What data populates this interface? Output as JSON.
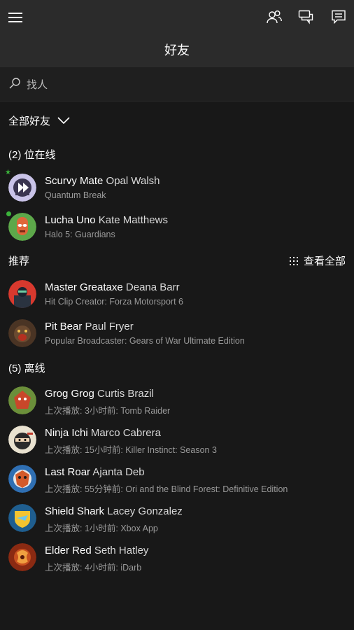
{
  "header": {
    "title": "好友"
  },
  "search": {
    "placeholder": "找人"
  },
  "filter": {
    "label": "全部好友"
  },
  "sections": {
    "online": {
      "title": "(2) 位在线"
    },
    "recommended": {
      "title": "推荐",
      "see_all_label": "查看全部"
    },
    "offline": {
      "title": "(5) 离线"
    }
  },
  "friends_online": [
    {
      "gamertag": "Scurvy Mate",
      "real_name": "Opal Walsh",
      "status": "Quantum Break",
      "presence": "star",
      "avatar_color": "#c9c3e8"
    },
    {
      "gamertag": "Lucha Uno",
      "real_name": "Kate Matthews",
      "status": "Halo 5: Guardians",
      "presence": "dot",
      "avatar_color": "#5da84a"
    }
  ],
  "recommended": [
    {
      "gamertag": "Master Greataxe",
      "real_name": "Deana Barr",
      "status": "Hit Clip Creator: Forza Motorsport 6",
      "avatar_color": "#d8392e"
    },
    {
      "gamertag": "Pit Bear",
      "real_name": "Paul Fryer",
      "status": "Popular Broadcaster: Gears of War Ultimate Edition",
      "avatar_color": "#4a3424"
    }
  ],
  "friends_offline": [
    {
      "gamertag": "Grog Grog",
      "real_name": "Curtis Brazil",
      "status": "上次播放: 3小时前: Tomb Raider",
      "avatar_color": "#6b8f3a"
    },
    {
      "gamertag": "Ninja Ichi",
      "real_name": "Marco Cabrera",
      "status": "上次播放: 15小时前: Killer Instinct: Season 3",
      "avatar_color": "#e9e2d0"
    },
    {
      "gamertag": "Last Roar",
      "real_name": "Ajanta Deb",
      "status": "上次播放: 55分钟前: Ori and the Blind Forest: Definitive Edition",
      "avatar_color": "#2f6fb3"
    },
    {
      "gamertag": "Shield Shark",
      "real_name": "Lacey Gonzalez",
      "status": "上次播放: 1小时前: Xbox App",
      "avatar_color": "#1f5e8f"
    },
    {
      "gamertag": "Elder Red",
      "real_name": "Seth Hatley",
      "status": "上次播放: 4小时前: iDarb",
      "avatar_color": "#8a2a12"
    }
  ],
  "colors": {
    "background": "#181818",
    "topbar": "#2b2b2b",
    "presence_green": "#3bb33b",
    "secondary_text": "#9a9a9a"
  },
  "icons": {
    "menu": "hamburger-icon",
    "friends": "people-icon",
    "messages": "messages-icon",
    "feed": "activity-feed-icon",
    "search": "search-icon",
    "filter_chevron": "chevron-down-icon",
    "see_all": "grid-icon"
  }
}
